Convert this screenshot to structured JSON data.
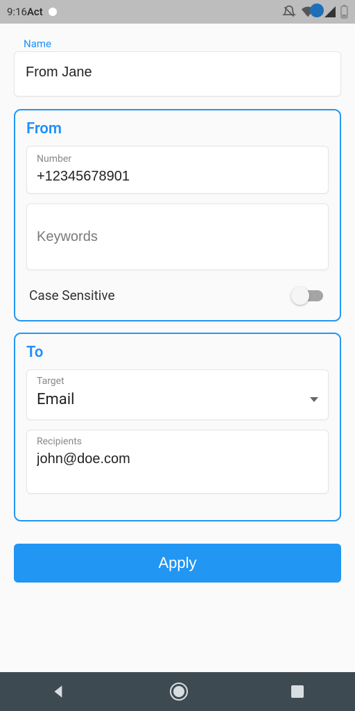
{
  "statusbar": {
    "time": "9:16",
    "title_fragment": "Act"
  },
  "name": {
    "label": "Name",
    "value": "From Jane"
  },
  "from": {
    "heading": "From",
    "number_label": "Number",
    "number_value": "+12345678901",
    "keywords_placeholder": "Keywords",
    "case_sensitive_label": "Case Sensitive",
    "case_sensitive_on": false
  },
  "to": {
    "heading": "To",
    "target_label": "Target",
    "target_value": "Email",
    "recipients_label": "Recipients",
    "recipients_value": "john@doe.com"
  },
  "actions": {
    "apply": "Apply"
  }
}
